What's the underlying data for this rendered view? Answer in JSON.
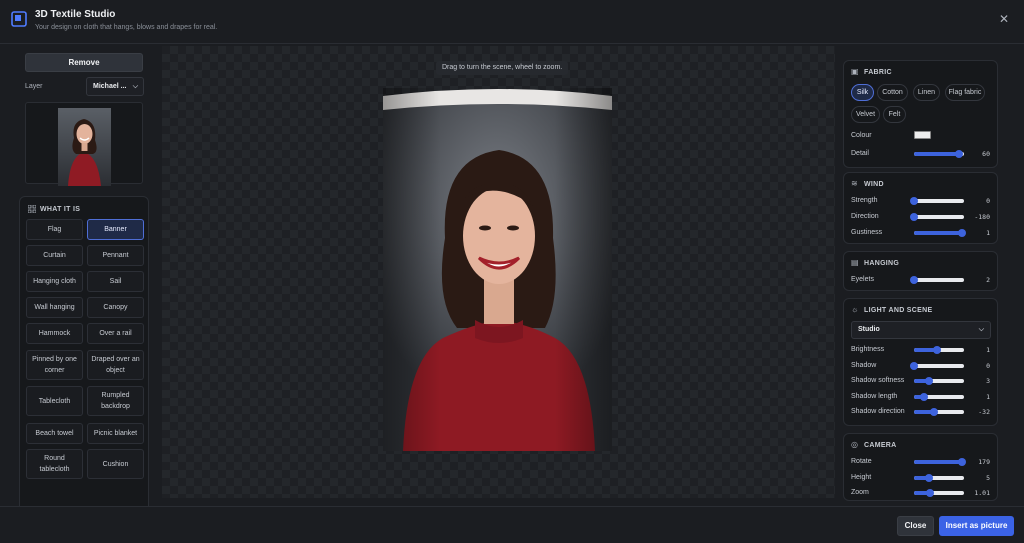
{
  "header": {
    "title": "3D Textile Studio",
    "subtitle": "Your design on cloth that hangs, blows and drapes for real.",
    "close_icon": "close-icon"
  },
  "layer": {
    "remove_label": "Remove",
    "label": "Layer",
    "selected": "Michael ..."
  },
  "what_it_is": {
    "title": "WHAT IT IS",
    "items": [
      {
        "label": "Flag",
        "selected": false
      },
      {
        "label": "Banner",
        "selected": true
      },
      {
        "label": "Curtain",
        "selected": false
      },
      {
        "label": "Pennant",
        "selected": false
      },
      {
        "label": "Hanging cloth",
        "selected": false
      },
      {
        "label": "Sail",
        "selected": false
      },
      {
        "label": "Wall hanging",
        "selected": false
      },
      {
        "label": "Canopy",
        "selected": false
      },
      {
        "label": "Hammock",
        "selected": false
      },
      {
        "label": "Over a rail",
        "selected": false
      },
      {
        "label": "Pinned by one corner",
        "selected": false
      },
      {
        "label": "Draped over an object",
        "selected": false
      },
      {
        "label": "Tablecloth",
        "selected": false
      },
      {
        "label": "Rumpled backdrop",
        "selected": false
      },
      {
        "label": "Beach towel",
        "selected": false
      },
      {
        "label": "Picnic blanket",
        "selected": false
      },
      {
        "label": "Round tablecloth",
        "selected": false
      },
      {
        "label": "Cushion",
        "selected": false
      }
    ]
  },
  "canvas": {
    "hint": "Drag to turn the scene, wheel to zoom."
  },
  "fabric": {
    "title": "FABRIC",
    "chips": [
      "Silk",
      "Cotton",
      "Linen",
      "Flag fabric",
      "Velvet",
      "Felt"
    ],
    "selected": "Silk",
    "colour_label": "Colour",
    "colour": "#eeeeee",
    "detail_label": "Detail",
    "detail_value": "60",
    "detail_fraction": 0.9
  },
  "wind": {
    "title": "WIND",
    "rows": [
      {
        "label": "Strength",
        "value": "0",
        "fraction": 0.0
      },
      {
        "label": "Direction",
        "value": "-180",
        "fraction": 0.0
      },
      {
        "label": "Gustiness",
        "value": "1",
        "fraction": 0.95
      }
    ]
  },
  "hanging": {
    "title": "HANGING",
    "rows": [
      {
        "label": "Eyelets",
        "value": "2",
        "fraction": 0.0
      }
    ]
  },
  "light": {
    "title": "LIGHT AND SCENE",
    "scene": "Studio",
    "rows": [
      {
        "label": "Brightness",
        "value": "1",
        "fraction": 0.45
      },
      {
        "label": "Shadow",
        "value": "0",
        "fraction": 0.0
      },
      {
        "label": "Shadow softness",
        "value": "3",
        "fraction": 0.3
      },
      {
        "label": "Shadow length",
        "value": "1",
        "fraction": 0.2
      },
      {
        "label": "Shadow direction",
        "value": "-32",
        "fraction": 0.4
      }
    ]
  },
  "camera": {
    "title": "CAMERA",
    "rows": [
      {
        "label": "Rotate",
        "value": "179",
        "fraction": 0.95
      },
      {
        "label": "Height",
        "value": "5",
        "fraction": 0.3
      },
      {
        "label": "Zoom",
        "value": "1.01",
        "fraction": 0.32
      }
    ]
  },
  "footer": {
    "close_label": "Close",
    "insert_label": "Insert as picture"
  },
  "colors": {
    "accent": "#3b63e6",
    "background": "#1b1d21",
    "panel": "#16181b"
  }
}
